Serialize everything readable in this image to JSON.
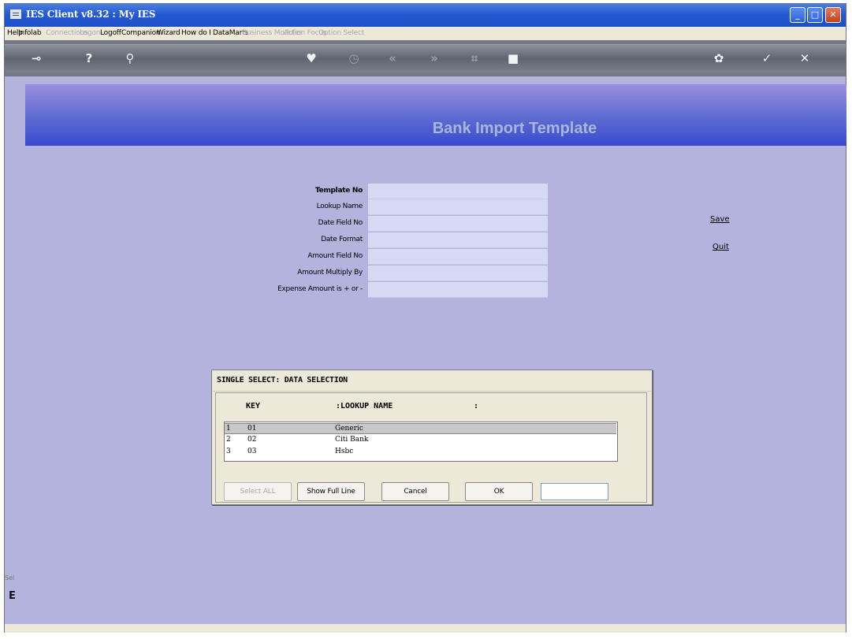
{
  "window": {
    "title": "IES Client v8.32 : My IES",
    "controls": {
      "minimize": "_",
      "maximize": "□",
      "close": "✕"
    }
  },
  "menu": [
    {
      "label": "Help",
      "enabled": true
    },
    {
      "label": "Infolab",
      "enabled": true
    },
    {
      "label": "Connections",
      "enabled": false
    },
    {
      "label": "Logon",
      "enabled": false
    },
    {
      "label": "Logoff",
      "enabled": true
    },
    {
      "label": "Companion",
      "enabled": true
    },
    {
      "label": "Wizard",
      "enabled": true
    },
    {
      "label": "How do I",
      "enabled": true
    },
    {
      "label": "DataMarts",
      "enabled": true
    },
    {
      "label": "Business Modules",
      "enabled": false
    },
    {
      "label": "Action Focus",
      "enabled": false
    },
    {
      "label": "Option Select",
      "enabled": false
    }
  ],
  "toolbar": {
    "icons": [
      {
        "name": "key-icon",
        "glyph": "⊸",
        "enabled": true
      },
      {
        "name": "help-icon",
        "glyph": "?",
        "enabled": true
      },
      {
        "name": "search-icon",
        "glyph": "⚲",
        "enabled": true
      },
      {
        "name": "heart-icon",
        "glyph": "♥",
        "enabled": true
      },
      {
        "name": "history-icon",
        "glyph": "◷",
        "enabled": false
      },
      {
        "name": "rewind-icon",
        "glyph": "«",
        "enabled": false
      },
      {
        "name": "forward-icon",
        "glyph": "»",
        "enabled": false
      },
      {
        "name": "tree-icon",
        "glyph": "⌗",
        "enabled": false
      },
      {
        "name": "stop-icon",
        "glyph": "■",
        "enabled": true
      },
      {
        "name": "settings-icon",
        "glyph": "✿",
        "enabled": true
      },
      {
        "name": "check-icon",
        "glyph": "✓",
        "enabled": true
      },
      {
        "name": "close-icon",
        "glyph": "✕",
        "enabled": true
      }
    ]
  },
  "page": {
    "title": "Bank Import Template",
    "fields": [
      {
        "label": "Template No",
        "value": ""
      },
      {
        "label": "Lookup Name",
        "value": ""
      },
      {
        "label": "Date Field No",
        "value": ""
      },
      {
        "label": "Date Format",
        "value": ""
      },
      {
        "label": "Amount Field No",
        "value": ""
      },
      {
        "label": "Amount Multiply By",
        "value": ""
      },
      {
        "label": "Expense Amount is + or -",
        "value": ""
      }
    ],
    "actions": {
      "save": "Save",
      "quit": "Quit"
    }
  },
  "dialog": {
    "title": "SINGLE SELECT: DATA SELECTION",
    "columns": {
      "key": "KEY",
      "lookup_name": ":LOOKUP NAME",
      "extra": ":"
    },
    "rows": [
      {
        "num": "1",
        "key": "01",
        "name": "Generic",
        "selected": true
      },
      {
        "num": "2",
        "key": "02",
        "name": "Citi Bank",
        "selected": false
      },
      {
        "num": "3",
        "key": "03",
        "name": "Hsbc",
        "selected": false
      }
    ],
    "buttons": {
      "select_all": "Select ALL",
      "show_full_line": "Show Full Line",
      "cancel": "Cancel",
      "ok": "OK"
    },
    "input_value": ""
  },
  "side": {
    "left_label_1": "Sel",
    "left_label_2": "E"
  }
}
